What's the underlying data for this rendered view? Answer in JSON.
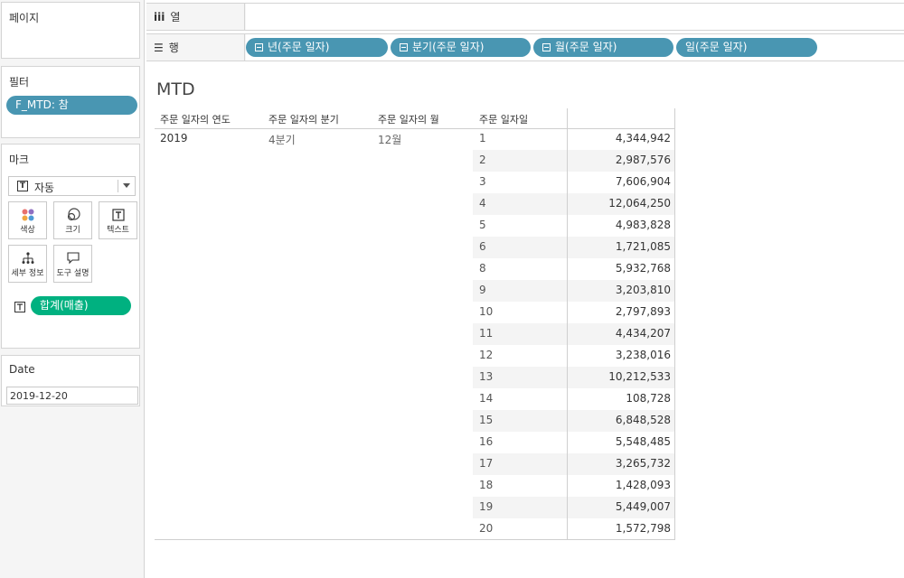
{
  "panels": {
    "pages": {
      "title": "페이지"
    },
    "filters": {
      "title": "필터",
      "pill": "F_MTD: 참"
    },
    "marks": {
      "title": "마크",
      "type_selected": "자동",
      "buttons": [
        {
          "label": "색상",
          "icon": "color-dots-icon"
        },
        {
          "label": "크기",
          "icon": "size-circles-icon"
        },
        {
          "label": "텍스트",
          "icon": "text-t-icon"
        },
        {
          "label": "세부 정보",
          "icon": "detail-tree-icon"
        },
        {
          "label": "도구 설명",
          "icon": "tooltip-bubble-icon"
        }
      ],
      "measure_pill": "합계(매출)"
    },
    "date": {
      "title": "Date",
      "value": "2019-12-20"
    }
  },
  "shelves": {
    "columns": {
      "label": "열",
      "icon": "columns-icon"
    },
    "rows": {
      "label": "행",
      "icon": "rows-icon",
      "pills": [
        "년(주문 일자)",
        "분기(주문 일자)",
        "월(주문 일자)",
        "일(주문 일자)"
      ]
    }
  },
  "view": {
    "title": "MTD",
    "headers": [
      "주문 일자의 연도",
      "주문 일자의 분기",
      "주문 일자의 월",
      "주문 일자일"
    ],
    "year": "2019",
    "quarter": "4분기",
    "month": "12월"
  },
  "chart_data": {
    "type": "table",
    "columns": [
      "주문 일자의 연도",
      "주문 일자의 분기",
      "주문 일자의 월",
      "주문 일자일",
      "합계(매출)"
    ],
    "rows": [
      {
        "day": "1",
        "value": "4,344,942"
      },
      {
        "day": "2",
        "value": "2,987,576"
      },
      {
        "day": "3",
        "value": "7,606,904"
      },
      {
        "day": "4",
        "value": "12,064,250"
      },
      {
        "day": "5",
        "value": "4,983,828"
      },
      {
        "day": "6",
        "value": "1,721,085"
      },
      {
        "day": "8",
        "value": "5,932,768"
      },
      {
        "day": "9",
        "value": "3,203,810"
      },
      {
        "day": "10",
        "value": "2,797,893"
      },
      {
        "day": "11",
        "value": "4,434,207"
      },
      {
        "day": "12",
        "value": "3,238,016"
      },
      {
        "day": "13",
        "value": "10,212,533"
      },
      {
        "day": "14",
        "value": "108,728"
      },
      {
        "day": "15",
        "value": "6,848,528"
      },
      {
        "day": "16",
        "value": "5,548,485"
      },
      {
        "day": "17",
        "value": "3,265,732"
      },
      {
        "day": "18",
        "value": "1,428,093"
      },
      {
        "day": "19",
        "value": "5,449,007"
      },
      {
        "day": "20",
        "value": "1,572,798"
      }
    ]
  }
}
